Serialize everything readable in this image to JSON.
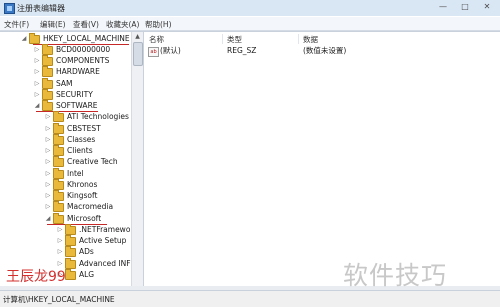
{
  "window": {
    "title": "注册表编辑器",
    "controls": [
      "—",
      "□",
      "✕"
    ]
  },
  "menu": [
    "文件(F)",
    "编辑(E)",
    "查看(V)",
    "收藏夹(A)",
    "帮助(H)"
  ],
  "tree": {
    "root": "HKEY_LOCAL_MACHINE",
    "level1": [
      "BCD00000000",
      "COMPONENTS",
      "HARDWARE",
      "SAM",
      "SECURITY",
      "SOFTWARE"
    ],
    "software_children": [
      "ATI Technologies",
      "CBSTEST",
      "Classes",
      "Clients",
      "Creative Tech",
      "Intel",
      "Khronos",
      "Kingsoft",
      "Macromedia",
      "Microsoft"
    ],
    "microsoft_children": [
      ".NETFramewor",
      "Active Setup",
      "ADs",
      "Advanced INF",
      "ALG"
    ]
  },
  "columns": [
    "名称",
    "类型",
    "数据"
  ],
  "values": [
    {
      "name": "(默认)",
      "type": "REG_SZ",
      "data": "(数值未设置)"
    }
  ],
  "status": "计算机\\HKEY_LOCAL_MACHINE",
  "watermarks": {
    "left": "王辰龙99",
    "right": "软件技巧"
  },
  "colors": {
    "titlebar": "#d9e6f3",
    "folder": "#e8b93a",
    "highlight_underline": "#c62828"
  }
}
